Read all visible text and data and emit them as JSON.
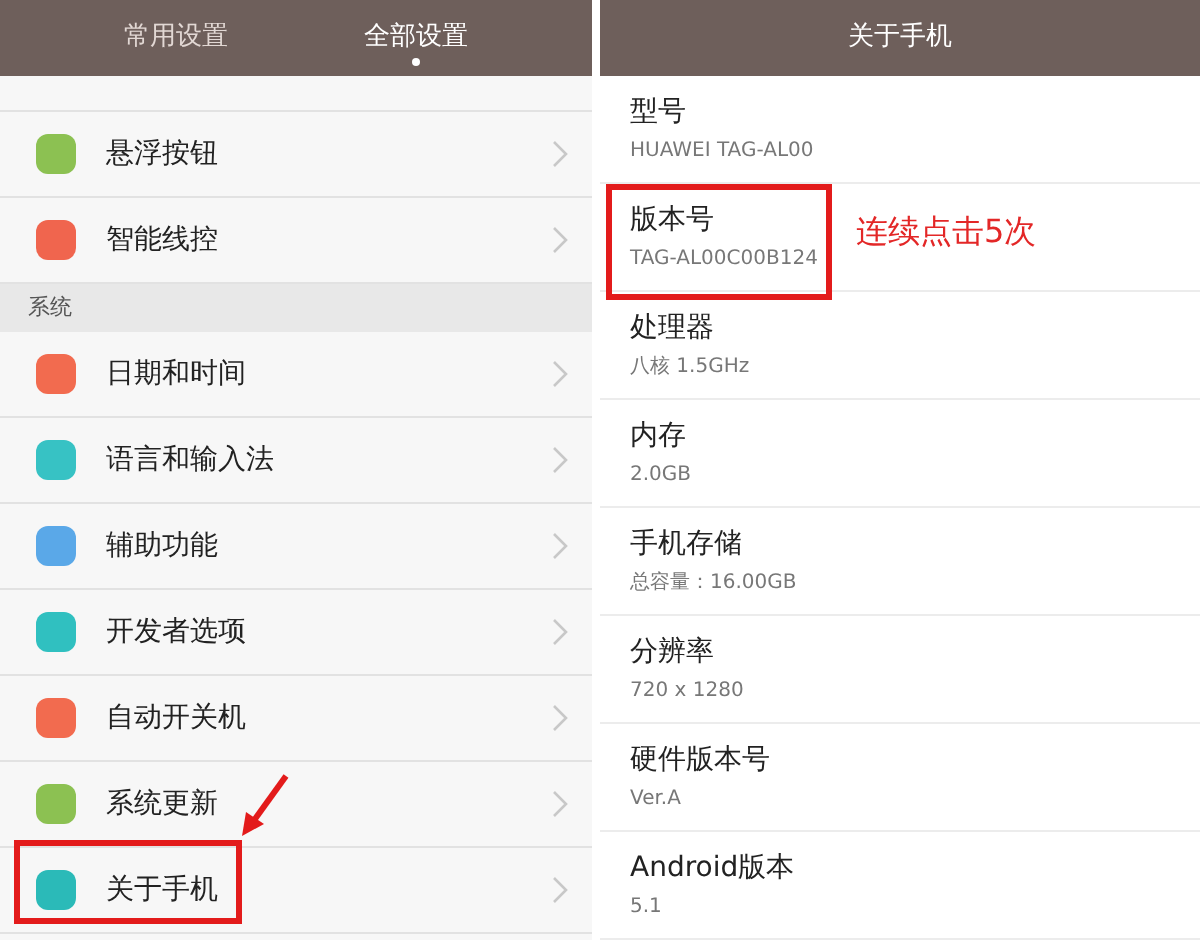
{
  "left_screen": {
    "tabs": [
      {
        "label": "常用设置",
        "selected": false
      },
      {
        "label": "全部设置",
        "selected": true
      }
    ],
    "groups": [
      {
        "items": [
          {
            "label": "悬浮按钮",
            "color": "#8cc152",
            "highlighted": false
          },
          {
            "label": "智能线控",
            "color": "#f0654e",
            "highlighted": false
          }
        ]
      },
      {
        "header": "系统",
        "items": [
          {
            "label": "日期和时间",
            "color": "#f26b4f",
            "highlighted": false
          },
          {
            "label": "语言和输入法",
            "color": "#37c2c4",
            "highlighted": false
          },
          {
            "label": "辅助功能",
            "color": "#5aa8e8",
            "highlighted": false
          },
          {
            "label": "开发者选项",
            "color": "#30c0c0",
            "highlighted": false
          },
          {
            "label": "自动开关机",
            "color": "#f26b4f",
            "highlighted": false
          },
          {
            "label": "系统更新",
            "color": "#8cc152",
            "highlighted": false
          },
          {
            "label": "关于手机",
            "color": "#2bbab8",
            "highlighted": true
          }
        ]
      }
    ]
  },
  "right_screen": {
    "title": "关于手机",
    "items": [
      {
        "title": "型号",
        "value": "HUAWEI TAG-AL00",
        "highlighted": false
      },
      {
        "title": "版本号",
        "value": "TAG-AL00C00B124",
        "highlighted": true,
        "note": "连续点击5次"
      },
      {
        "title": "处理器",
        "value": "八核 1.5GHz",
        "highlighted": false
      },
      {
        "title": "内存",
        "value": "2.0GB",
        "highlighted": false
      },
      {
        "title": "手机存储",
        "value": "总容量：16.00GB",
        "highlighted": false
      },
      {
        "title": "分辨率",
        "value": "720 x 1280",
        "highlighted": false
      },
      {
        "title": "硬件版本号",
        "value": "Ver.A",
        "highlighted": false
      },
      {
        "title": "Android版本",
        "value": "5.1",
        "highlighted": false
      }
    ]
  }
}
